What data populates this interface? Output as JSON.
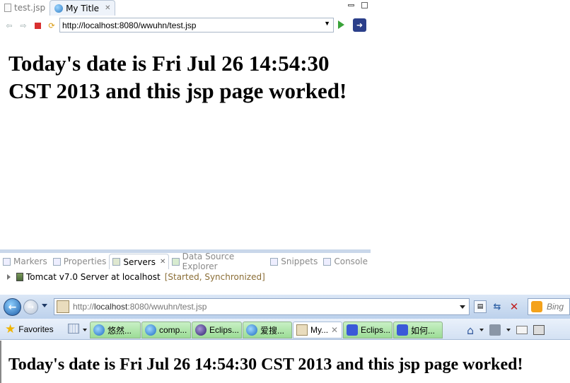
{
  "eclipse": {
    "editor_tabs": [
      {
        "label": "test.jsp",
        "active": false
      },
      {
        "label": "My Title",
        "active": true
      }
    ],
    "url": "http://localhost:8080/wwuhn/test.jsp",
    "content": "Today's date is Fri Jul 26 14:54:30 CST 2013 and this jsp page worked!"
  },
  "views": {
    "tabs": [
      {
        "label": "Markers",
        "active": false
      },
      {
        "label": "Properties",
        "active": false
      },
      {
        "label": "Servers",
        "active": true
      },
      {
        "label": "Data Source Explorer",
        "active": false
      },
      {
        "label": "Snippets",
        "active": false
      },
      {
        "label": "Console",
        "active": false
      }
    ],
    "server": {
      "name": "Tomcat v7.0 Server at localhost",
      "status": "[Started, Synchronized]"
    }
  },
  "ie": {
    "url_prefix": "http://",
    "url_host": "localhost",
    "url_rest": ":8080/wwuhn/test.jsp",
    "search_placeholder": "Bing",
    "favorites_label": "Favorites",
    "tabs": [
      {
        "label": "悠然...",
        "icon": "ie"
      },
      {
        "label": "comp...",
        "icon": "ie"
      },
      {
        "label": "Eclips...",
        "icon": "ecl"
      },
      {
        "label": "爱搜...",
        "icon": "ie"
      },
      {
        "label": "My...",
        "icon": "jsp",
        "selected": true
      },
      {
        "label": "Eclips...",
        "icon": "paw"
      },
      {
        "label": "如何...",
        "icon": "paw"
      }
    ],
    "content": "Today's date is Fri Jul 26 14:54:30 CST 2013 and this jsp page worked!"
  }
}
